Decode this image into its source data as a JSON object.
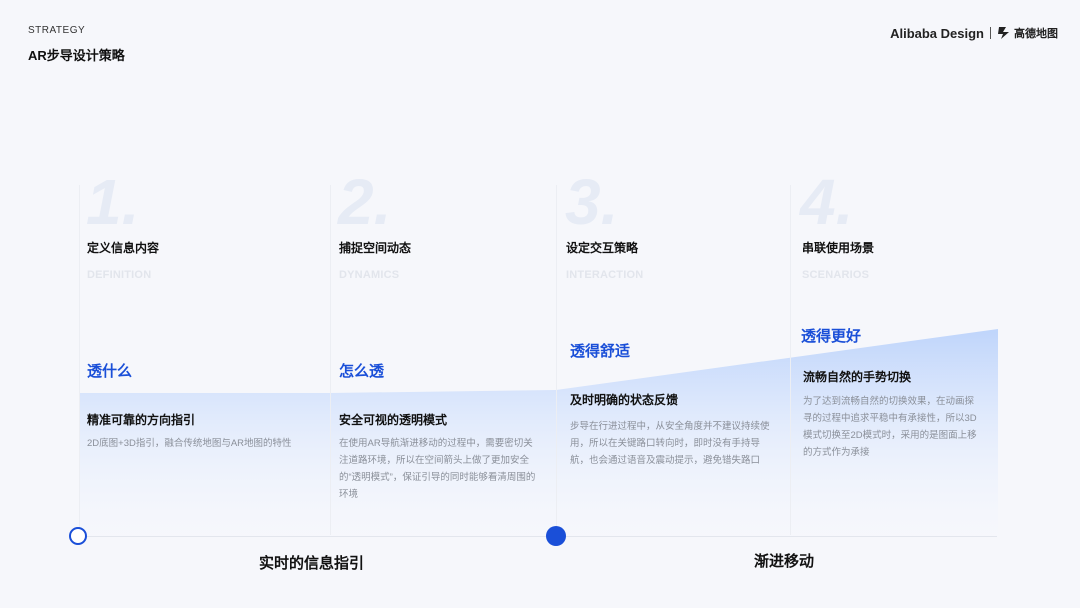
{
  "header": {
    "eyebrow": "STRATEGY",
    "title": "AR步导设计策略",
    "brand": "Alibaba Design",
    "partner": "高德地图"
  },
  "steps": [
    {
      "number": "1.",
      "title": "定义信息内容",
      "en": "DEFINITION",
      "phase": "透什么",
      "subtitle": "精准可靠的方向指引",
      "desc": "2D底图+3D指引，融合传统地图与AR地图的特性"
    },
    {
      "number": "2.",
      "title": "捕捉空间动态",
      "en": "DYNAMICS",
      "phase": "怎么透",
      "subtitle": "安全可视的透明模式",
      "desc": "在使用AR导航渐进移动的过程中，需要密切关注道路环境，所以在空间箭头上做了更加安全的“透明模式”，保证引导的同时能够看清周围的环境"
    },
    {
      "number": "3.",
      "title": "设定交互策略",
      "en": "INTERACTION",
      "phase": "透得舒适",
      "subtitle": "及时明确的状态反馈",
      "desc": "步导在行进过程中，从安全角度并不建议持续使用，所以在关键路口转向时，即时没有手持导航，也会通过语音及震动提示，避免错失路口"
    },
    {
      "number": "4.",
      "title": "串联使用场景",
      "en": "SCENARIOS",
      "phase": "透得更好",
      "subtitle": "流畅自然的手势切换",
      "desc": "为了达到流畅自然的切换效果，在动画探寻的过程中追求平稳中有承接性，所以3D模式切换至2D模式时，采用的是图面上移的方式作为承接"
    }
  ],
  "timeline": {
    "left_label": "实时的信息指引",
    "right_label": "渐进移动"
  },
  "colors": {
    "accent": "#1a4fd8",
    "gradient_top": "#bcd3fb",
    "gradient_bottom": "#f4f7fd"
  }
}
